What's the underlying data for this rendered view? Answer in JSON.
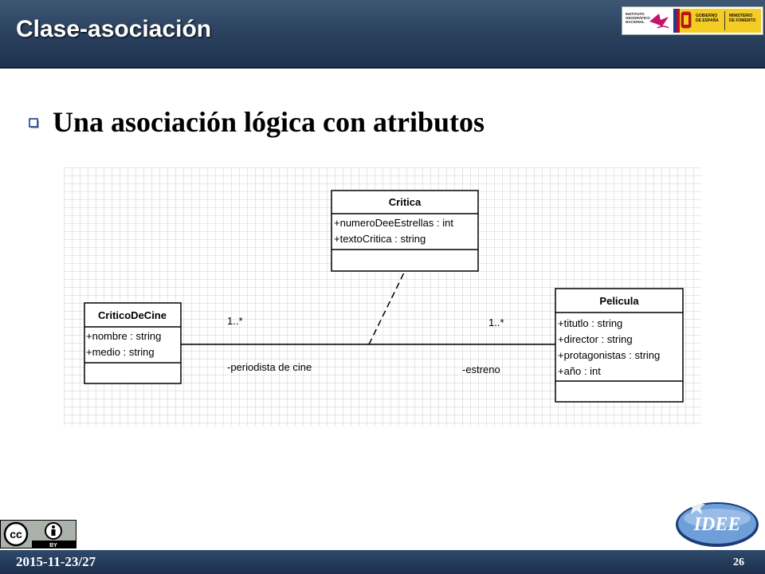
{
  "header": {
    "title": "Clase-asociación",
    "logos": {
      "ign_text": "INSTITUTO GEOGRÁFICO NACIONAL",
      "gob_line1": "GOBIERNO",
      "gob_line2": "DE ESPAÑA",
      "min_line1": "MINISTERIO",
      "min_line2": "DE FOMENTO"
    }
  },
  "main": {
    "bullet": "Una asociación lógica con atributos"
  },
  "diagram": {
    "classes": {
      "critica": {
        "name": "Critica",
        "attributes": [
          "+numeroDeeEstrellas : int",
          "+textoCritica : string"
        ]
      },
      "critico": {
        "name": "CriticoDeCine",
        "attributes": [
          "+nombre : string",
          "+medio : string"
        ]
      },
      "pelicula": {
        "name": "Pelicula",
        "attributes": [
          "+titutlo : string",
          "+director : string",
          "+protagonistas : string",
          "+año : int"
        ]
      }
    },
    "association": {
      "left_multiplicity": "1..*",
      "right_multiplicity": "1..*",
      "left_role": "-periodista de cine",
      "right_role": "-estreno"
    }
  },
  "footer": {
    "date": "2015-11-23/27",
    "page": "26",
    "cc_label": "BY",
    "idee_label": "IDEE"
  },
  "colors": {
    "header": "#2c4360",
    "bullet": "#1f3c88",
    "idee": "#6f9fd8"
  }
}
